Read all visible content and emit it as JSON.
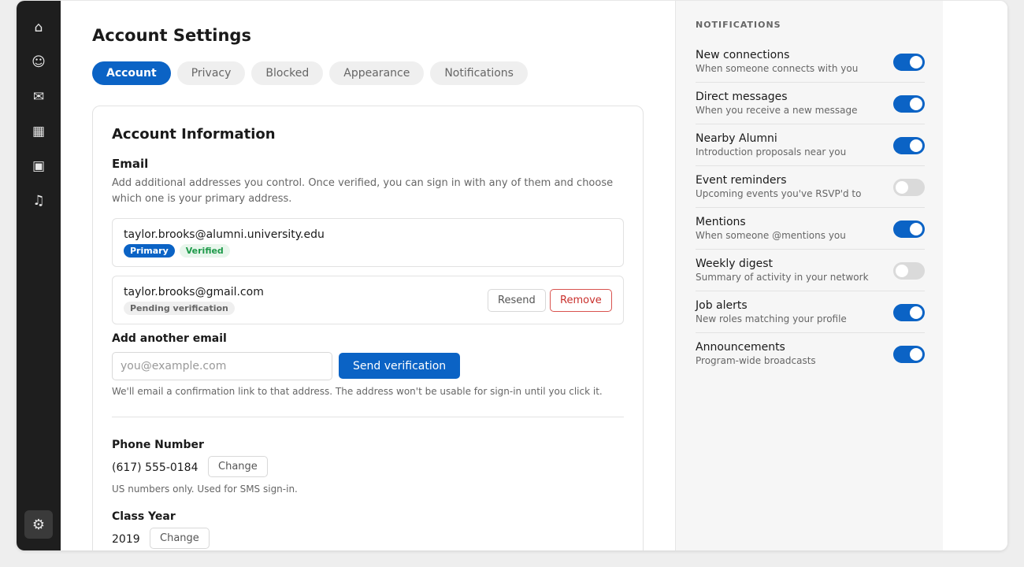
{
  "page": {
    "title": "Account Settings"
  },
  "rail": {
    "items": [
      {
        "icon": "home-icon",
        "glyph": "⌂"
      },
      {
        "icon": "people-icon",
        "glyph": "☺"
      },
      {
        "icon": "message-icon",
        "glyph": "✉"
      },
      {
        "icon": "calendar-icon",
        "glyph": "▦"
      },
      {
        "icon": "briefcase-icon",
        "glyph": "▣"
      },
      {
        "icon": "bell-icon",
        "glyph": "♫"
      }
    ],
    "settings_glyph": "⚙"
  },
  "tabs": [
    {
      "label": "Account",
      "active": true
    },
    {
      "label": "Privacy",
      "active": false
    },
    {
      "label": "Blocked",
      "active": false
    },
    {
      "label": "Appearance",
      "active": false
    },
    {
      "label": "Notifications",
      "active": false
    }
  ],
  "account": {
    "card_title": "Account Information",
    "email_label": "Email",
    "email_help": "Add additional addresses you control. Once verified, you can sign in with any of them and choose which one is your primary address.",
    "emails": [
      {
        "address": "taylor.brooks@alumni.university.edu",
        "badges": [
          "Primary",
          "Verified"
        ]
      },
      {
        "address": "taylor.brooks@gmail.com",
        "badges": [
          "Pending verification"
        ],
        "resend_label": "Resend",
        "remove_label": "Remove"
      }
    ],
    "add_email_label": "Add another email",
    "add_email_placeholder": "you@example.com",
    "send_verification_label": "Send verification",
    "add_email_help": "We'll email a confirmation link to that address. The address won't be usable for sign-in until you click it.",
    "phone_label": "Phone Number",
    "phone_value": "(617) 555-0184",
    "phone_change_label": "Change",
    "phone_help": "US numbers only. Used for SMS sign-in.",
    "class_year_label": "Class Year",
    "class_year_value": "2019",
    "class_year_change_label": "Change"
  },
  "notifications": {
    "heading": "NOTIFICATIONS",
    "items": [
      {
        "title": "New connections",
        "desc": "When someone connects with you",
        "on": true
      },
      {
        "title": "Direct messages",
        "desc": "When you receive a new message",
        "on": true
      },
      {
        "title": "Nearby Alumni",
        "desc": "Introduction proposals near you",
        "on": true
      },
      {
        "title": "Event reminders",
        "desc": "Upcoming events you've RSVP'd to",
        "on": false
      },
      {
        "title": "Mentions",
        "desc": "When someone @mentions you",
        "on": true
      },
      {
        "title": "Weekly digest",
        "desc": "Summary of activity in your network",
        "on": false
      },
      {
        "title": "Job alerts",
        "desc": "New roles matching your profile",
        "on": true
      },
      {
        "title": "Announcements",
        "desc": "Program-wide broadcasts",
        "on": true
      }
    ]
  },
  "colors": {
    "accent": "#0b63c5",
    "rail_bg": "#1e1e1e",
    "verified_text": "#1e9a4a",
    "danger": "#c9302c"
  }
}
